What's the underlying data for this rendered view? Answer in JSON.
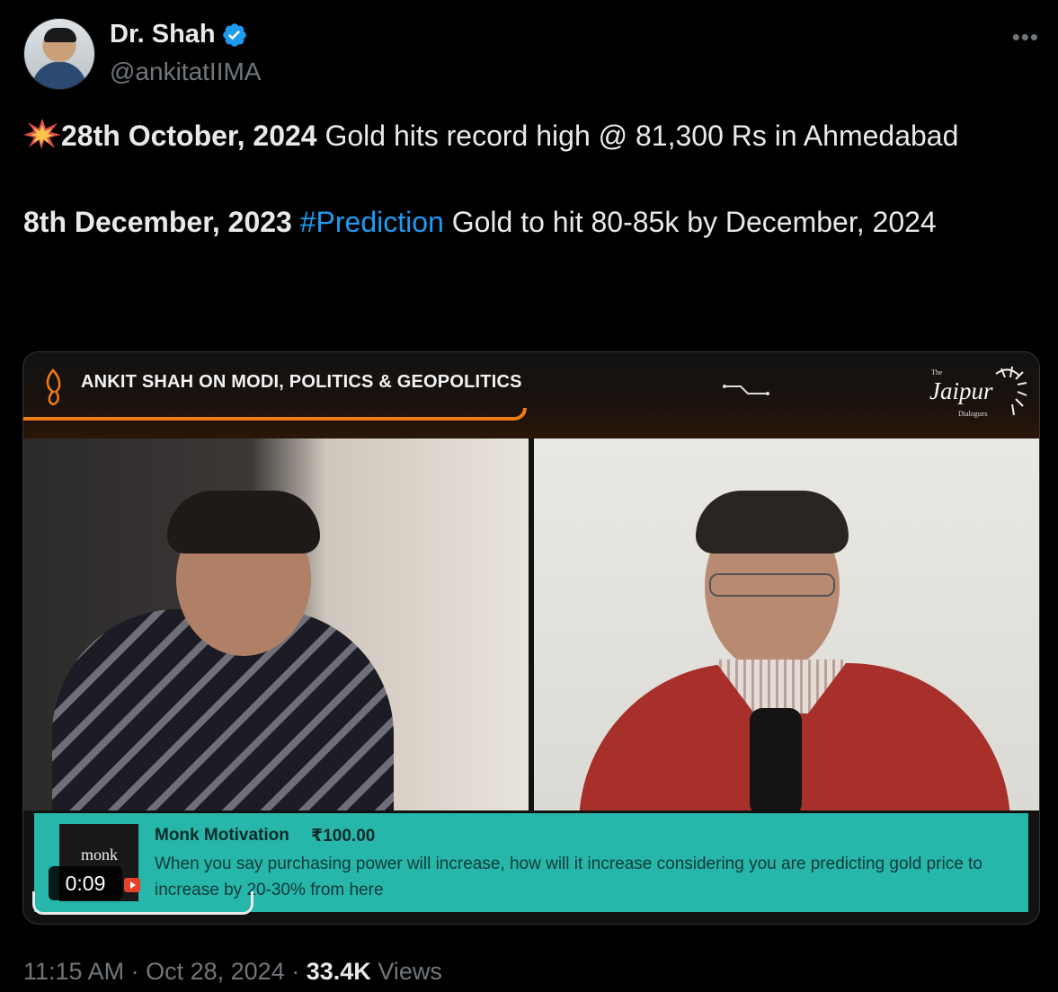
{
  "author": {
    "display_name": "Dr. Shah",
    "handle": "@ankitatIIMA",
    "verified": true,
    "verified_color": "#1d9bf0"
  },
  "more_icon": "more-horizontal-icon",
  "tweet": {
    "line1_bold": "28th October, 2024",
    "line1_rest": " Gold hits record high @ 81,300 Rs in Ahmedabad",
    "line2_bold": "8th December, 2023",
    "line2_hashtag": "#Prediction",
    "line2_rest": " Gold to hit 80-85k by December, 2024",
    "hashtag_color": "#1d9bf0"
  },
  "video": {
    "banner_title": "ANKIT SHAH ON MODI, POLITICS & GEOPOLITICS",
    "logo_the": "The",
    "logo_main": "Jaipur",
    "logo_sub": "Dialogues",
    "accent_color": "#f07b1a",
    "comment": {
      "thumb_text": "monk",
      "author": "Monk Motivation",
      "amount": "₹100.00",
      "text": "When you say purchasing power will increase, how will it increase considering you are predicting gold price to increase by 20-30% from here",
      "background": "#26b6aa"
    },
    "duration": "0:09"
  },
  "footer": {
    "time": "11:15 AM",
    "date": "Oct 28, 2024",
    "views_count": "33.4K",
    "views_label": "Views",
    "separator": "·"
  }
}
